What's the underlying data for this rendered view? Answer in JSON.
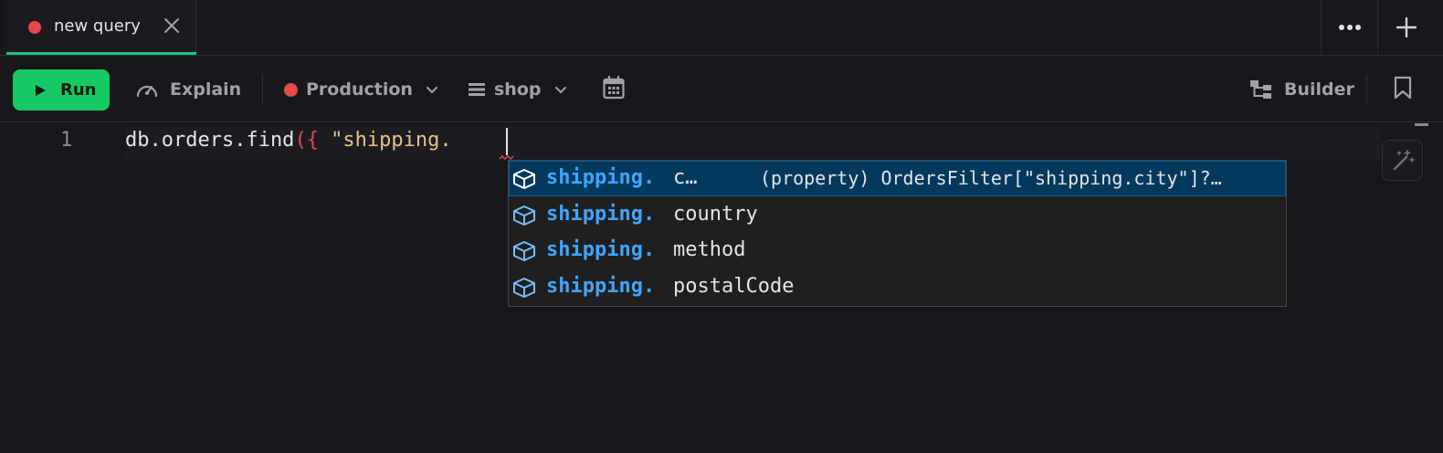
{
  "tab": {
    "label": "new query"
  },
  "toolbar": {
    "run_label": "Run",
    "explain_label": "Explain",
    "connection_label": "Production",
    "connection_color": "#e5484d",
    "database_label": "shop",
    "builder_label": "Builder"
  },
  "editor": {
    "line_number": "1",
    "code_prefix": "db.orders.find",
    "code_paren": "(",
    "code_brace": "{",
    "code_string": " \"shipping."
  },
  "suggest": {
    "items": [
      {
        "match": "shipping.",
        "rest": "c…",
        "detail": "(property) OrdersFilter[\"shipping.city\"]?…",
        "selected": true
      },
      {
        "match": "shipping.",
        "rest": "country",
        "detail": ""
      },
      {
        "match": "shipping.",
        "rest": "method",
        "detail": ""
      },
      {
        "match": "shipping.",
        "rest": "postalCode",
        "detail": ""
      }
    ]
  },
  "colors": {
    "accent": "#17c964",
    "error": "#e5484d",
    "suggest_match": "#3ea6ff",
    "suggest_selected": "#04395e"
  },
  "icons": [
    "close-icon",
    "more-icon",
    "plus-icon",
    "play-icon",
    "gauge-icon",
    "chevron-down-icon",
    "list-icon",
    "calendar-icon",
    "builder-icon",
    "bookmark-icon",
    "magic-wand-icon",
    "property-icon"
  ]
}
